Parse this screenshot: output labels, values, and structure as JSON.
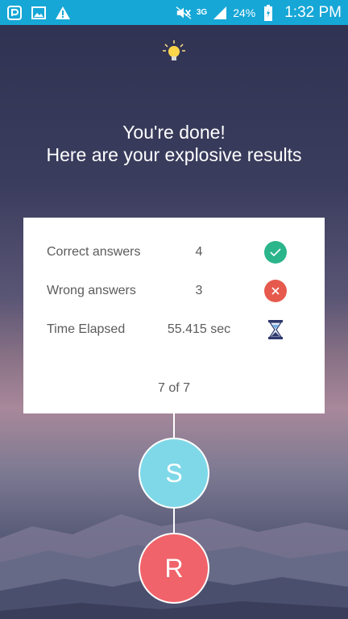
{
  "status_bar": {
    "network_type": "3G",
    "battery": "24%",
    "time": "1:32 PM",
    "icons": [
      "notification-p-icon",
      "image-icon",
      "warning-icon",
      "mute-icon",
      "signal-icon",
      "battery-charging-icon"
    ],
    "background_color": "#16a7d6"
  },
  "headline": {
    "line1": "You're done!",
    "line2": "Here are your explosive results"
  },
  "results": {
    "rows": [
      {
        "label": "Correct answers",
        "value": "4",
        "icon": "check-circle-icon",
        "color": "#2bb58a"
      },
      {
        "label": "Wrong answers",
        "value": "3",
        "icon": "close-circle-icon",
        "color": "#e65a4d"
      },
      {
        "label": "Time Elapsed",
        "value": "55.415 sec",
        "icon": "hourglass-icon",
        "color": "#2f3a6e"
      }
    ],
    "pager": "7 of 7"
  },
  "nodes": {
    "top": {
      "label": "S",
      "color": "#7fd8e8"
    },
    "bottom": {
      "label": "R",
      "color": "#f0636a"
    }
  }
}
